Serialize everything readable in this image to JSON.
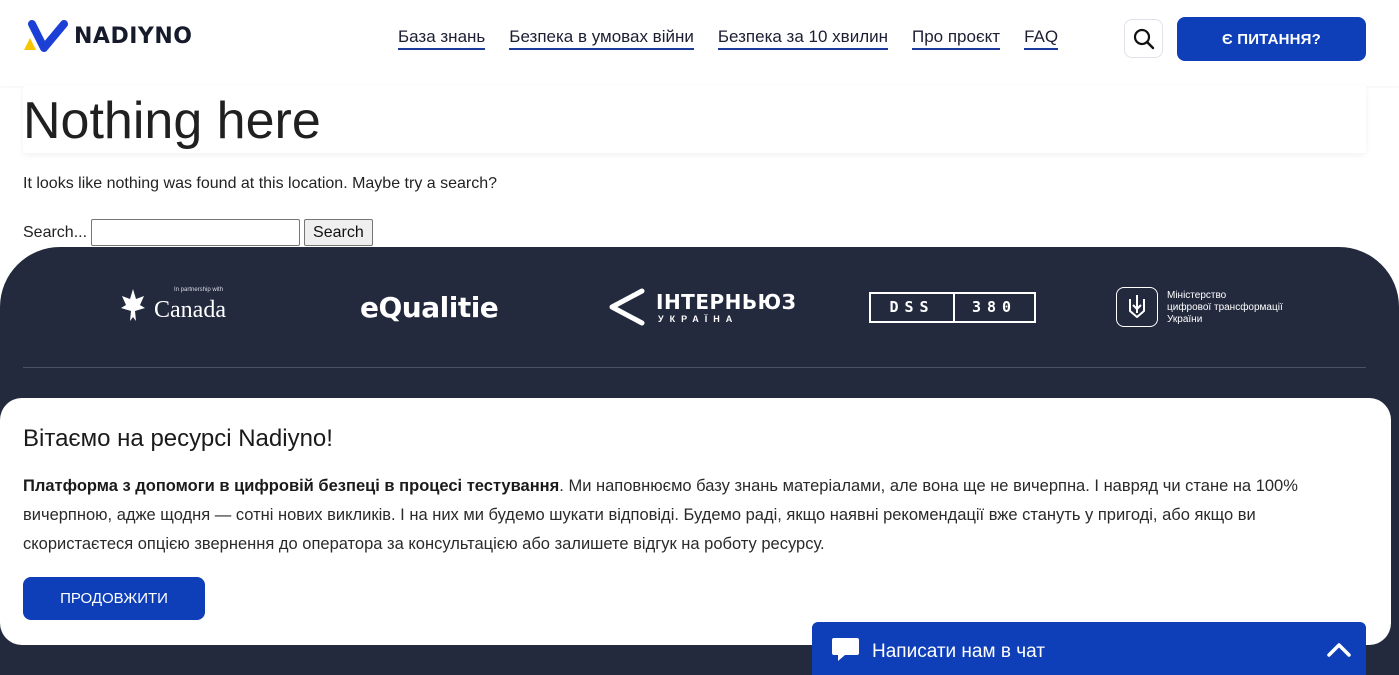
{
  "header": {
    "logo_text": "NADIYNO",
    "nav": [
      {
        "label": "База знань"
      },
      {
        "label": "Безпека в умовах війни"
      },
      {
        "label": "Безпека за 10 хвилин"
      },
      {
        "label": "Про проєкт"
      },
      {
        "label": "FAQ"
      }
    ],
    "search_icon": "search-icon",
    "cta_label": "Є ПИТАННЯ?"
  },
  "main": {
    "title": "Nothing here",
    "message": "It looks like nothing was found at this location. Maybe try a search?",
    "search_label": "Search...",
    "search_value": "",
    "search_button": "Search"
  },
  "footer": {
    "partners": [
      {
        "name": "In partnership with Canada",
        "small": "In partnership with",
        "main": "Canada"
      },
      {
        "name": "eQualitie",
        "main": "eQualitie"
      },
      {
        "name": "Інтерньюз Україна",
        "main": "ІНТЕРНЬЮЗ",
        "sub": "УКРАЇНА"
      },
      {
        "name": "DSS 380",
        "left": "DSS",
        "right": "380"
      },
      {
        "name": "Міністерство цифрової трансформації України",
        "line1": "Міністерство",
        "line2": "цифрової трансформації",
        "line3": "України"
      }
    ]
  },
  "welcome": {
    "title": "Вітаємо на ресурсі Nadiyno!",
    "bold_text": "Платформа з допомоги в цифровій безпеці в процесі тестування",
    "body_text": ". Ми наповнюємо базу знань матеріалами, але вона ще не вичерпна. І навряд чи стане на 100% вичерпною, адже щодня — сотні нових викликів. І на них ми будемо шукати відповіді. Будемо раді, якщо наявні рекомендації вже стануть у пригоді, або якщо ви скористаєтеся опцією звернення до оператора за консультацією або залишете відгук на роботу ресурсу.",
    "button_label": "ПРОДОВЖИТИ"
  },
  "chat": {
    "label": "Написати нам в чат"
  },
  "colors": {
    "brand_blue": "#0e3fb8",
    "footer_bg": "#232a3e",
    "logo_yellow": "#f7c600"
  }
}
